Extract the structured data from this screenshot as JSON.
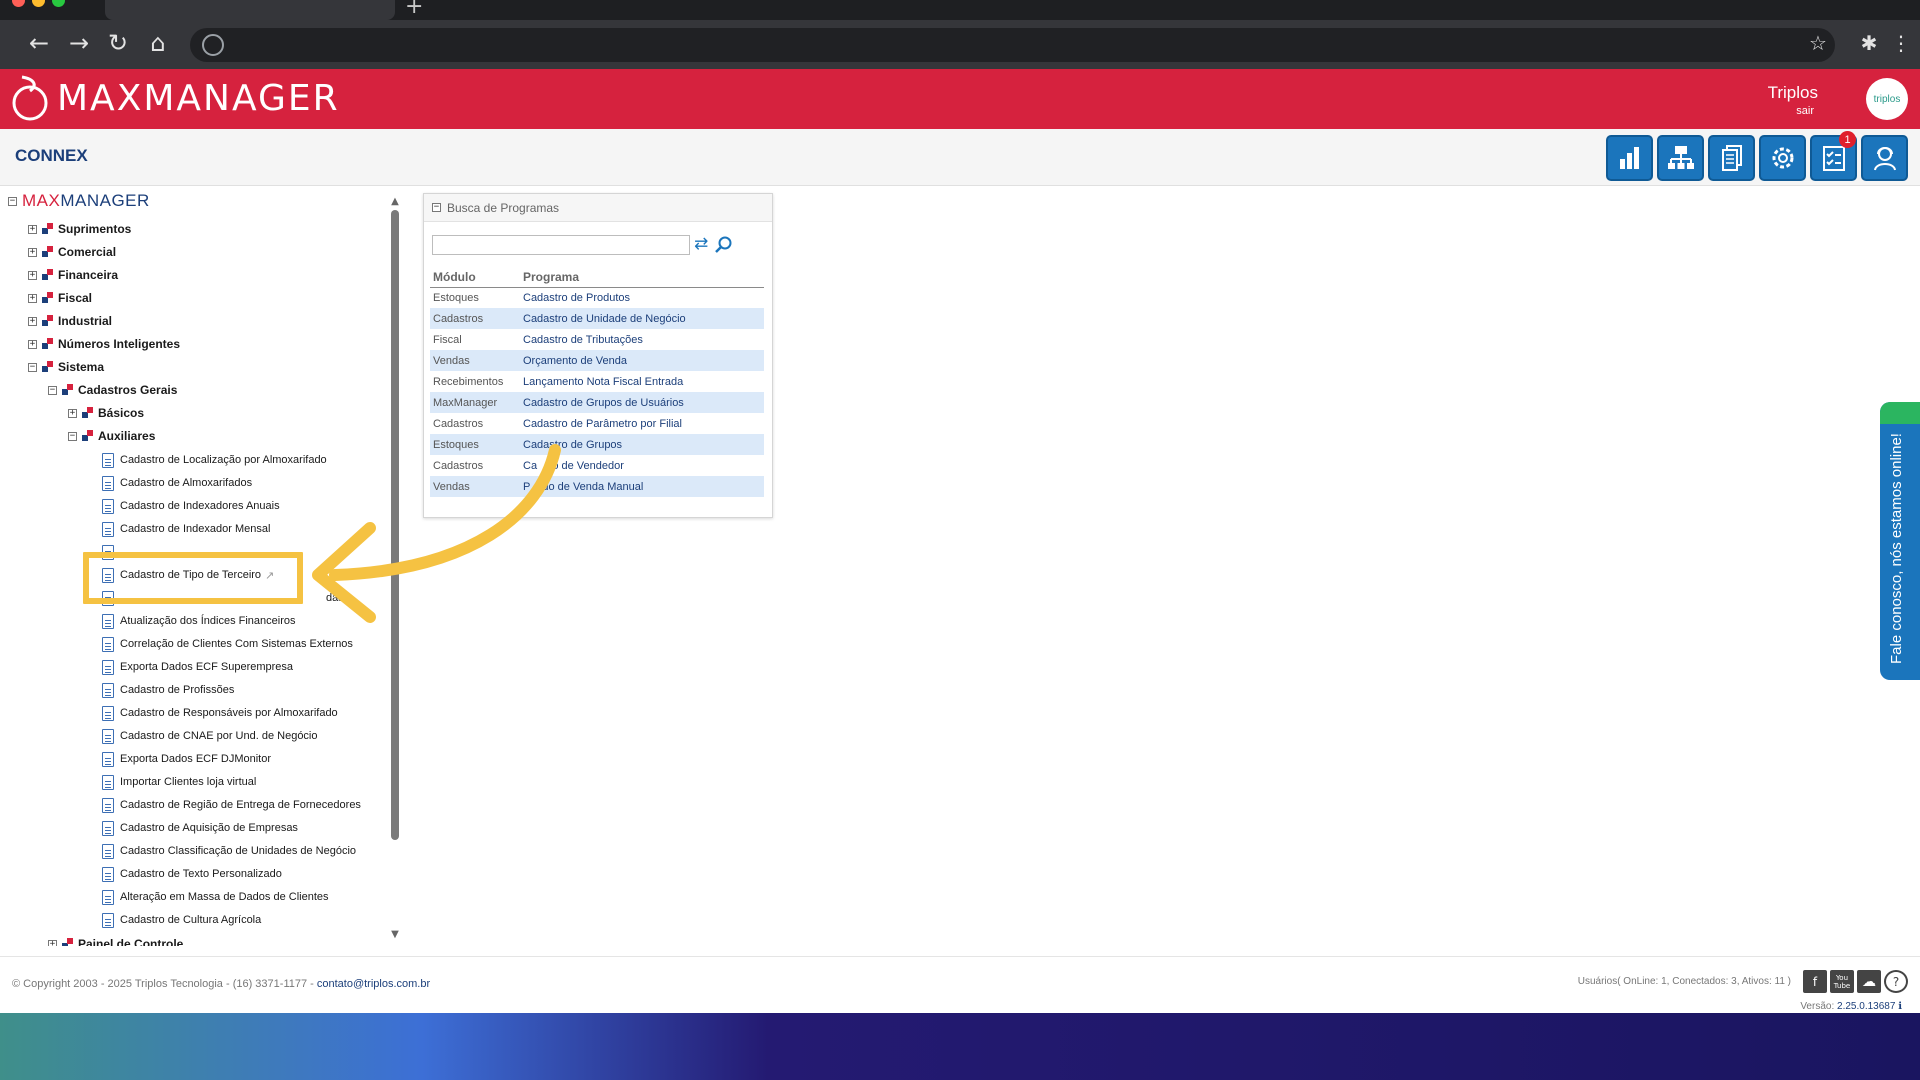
{
  "app": {
    "brand": "MAXMANAGER",
    "module": "CONNEX",
    "user": "Triplos",
    "logout": "sair",
    "avatar_label": "triplos",
    "notifications": "1"
  },
  "tree": {
    "root": {
      "pre": "MAX",
      "post": "MANAGER"
    },
    "top_items": [
      "Suprimentos",
      "Comercial",
      "Financeira",
      "Fiscal",
      "Industrial",
      "Números Inteligentes",
      "Sistema"
    ],
    "cadastros_gerais": "Cadastros Gerais",
    "basicos": "Básicos",
    "auxiliares": "Auxiliares",
    "leaves": [
      "Cadastro de Localização por Almoxarifado",
      "Cadastro de Almoxarifados",
      "Cadastro de Indexadores Anuais",
      "Cadastro de Indexador Mensal",
      "",
      "Cadastro de Tipo de Terceiro",
      "",
      "Atualização dos Índices Financeiros",
      "Correlação de Clientes Com Sistemas Externos",
      "Exporta Dados ECF Superempresa",
      "Cadastro de Profissões",
      "Cadastro de Responsáveis por Almoxarifado",
      "Cadastro de CNAE por Und. de Negócio",
      "Exporta Dados ECF DJMonitor",
      "Importar Clientes loja virtual",
      "Cadastro de Região de Entrega de Fornecedores",
      "Cadastro de Aquisição de Empresas",
      "Cadastro Classificação de Unidades de Negócio",
      "Cadastro de Texto Personalizado",
      "Alteração em Massa de Dados de Clientes",
      "Cadastro de Cultura Agrícola"
    ],
    "partial_leaf_suffix": "das",
    "painel": "Painel de Controle"
  },
  "search": {
    "title": "Busca de Programas",
    "input_value": "",
    "columns": [
      "Módulo",
      "Programa"
    ],
    "rows": [
      [
        "Estoques",
        "Cadastro de Produtos"
      ],
      [
        "Cadastros",
        "Cadastro de Unidade de Negócio"
      ],
      [
        "Fiscal",
        "Cadastro de Tributações"
      ],
      [
        "Vendas",
        "Orçamento de Venda"
      ],
      [
        "Recebimentos",
        "Lançamento Nota Fiscal Entrada"
      ],
      [
        "MaxManager",
        "Cadastro de Grupos de Usuários"
      ],
      [
        "Cadastros",
        "Cadastro de Parâmetro por Filial"
      ],
      [
        "Estoques",
        "Cadastro de Grupos"
      ],
      [
        "Cadastros",
        "Ca     o de Vendedor"
      ],
      [
        "Vendas",
        "P    do de Venda Manual"
      ]
    ]
  },
  "chat": {
    "label": "Fale conosco, nós estamos online!"
  },
  "footer": {
    "copyright": "© Copyright 2003 - 2025 Triplos Tecnologia - (16) 3371-1177 - ",
    "contact": "contato@triplos.com.br",
    "users": "Usuários( OnLine: 1, Conectados: 3, Ativos: 11 )",
    "version_label": "Versão:",
    "version": "2.25.0.13687",
    "social": [
      "f",
      "You Tube",
      "☁",
      "?"
    ]
  },
  "colors": {
    "brand_red": "#d6223e",
    "brand_blue": "#1c3f7a",
    "button_blue": "#1b75bc",
    "highlight_yellow": "#f5c242",
    "chat_green": "#2bb560"
  },
  "icons": [
    "reports-icon",
    "network-icon",
    "documents-icon",
    "settings-gear-icon",
    "tasks-icon",
    "support-agent-icon"
  ]
}
